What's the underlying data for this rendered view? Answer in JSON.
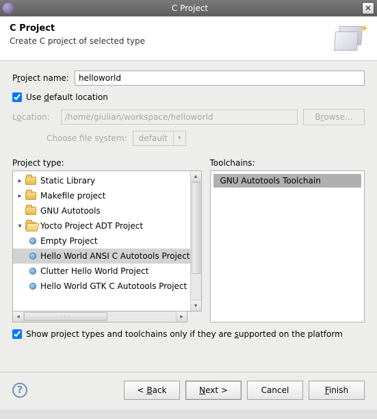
{
  "window": {
    "title": "C Project"
  },
  "header": {
    "title": "C Project",
    "subtitle": "Create C project of selected type"
  },
  "form": {
    "project_name_label_pre": "P",
    "project_name_label_u": "r",
    "project_name_label_post": "oject name:",
    "project_name_value": "helloworld",
    "use_default_pre": "Use ",
    "use_default_u": "d",
    "use_default_post": "efault location",
    "use_default_checked": true,
    "location_label_pre": "L",
    "location_label_u": "o",
    "location_label_post": "cation:",
    "location_value": "/home/giulian/workspace/helloworld",
    "browse_label_pre": "B",
    "browse_label_u": "r",
    "browse_label_post": "owse...",
    "fs_label_pre": "Choose file s",
    "fs_label_u": "y",
    "fs_label_post": "stem:",
    "fs_value": "default"
  },
  "lists": {
    "project_type_label": "Project type:",
    "toolchains_label": "Toolchains:",
    "tree": [
      {
        "type": "folder",
        "expand": "closed",
        "label": "Static Library"
      },
      {
        "type": "folder",
        "expand": "closed",
        "label": "Makefile project"
      },
      {
        "type": "folder",
        "expand": "none",
        "label": "GNU Autotools"
      },
      {
        "type": "folder",
        "expand": "open",
        "label": "Yocto Project ADT Project"
      },
      {
        "type": "leaf",
        "label": "Empty Project"
      },
      {
        "type": "leaf",
        "label": "Hello World ANSI C Autotools Project",
        "selected": true
      },
      {
        "type": "leaf",
        "label": "Clutter Hello World Project"
      },
      {
        "type": "leaf",
        "label": "Hello World GTK C Autotools Project"
      }
    ],
    "toolchain_selected": "GNU Autotools Toolchain"
  },
  "support": {
    "pre": "Show project types and toolchains only if they are ",
    "u": "s",
    "post": "upported on the platform",
    "checked": true
  },
  "footer": {
    "back_sym": "< ",
    "back_u": "B",
    "back_post": "ack",
    "next_u": "N",
    "next_post": "ext >",
    "cancel": "Cancel",
    "finish_u": "F",
    "finish_post": "inish"
  }
}
